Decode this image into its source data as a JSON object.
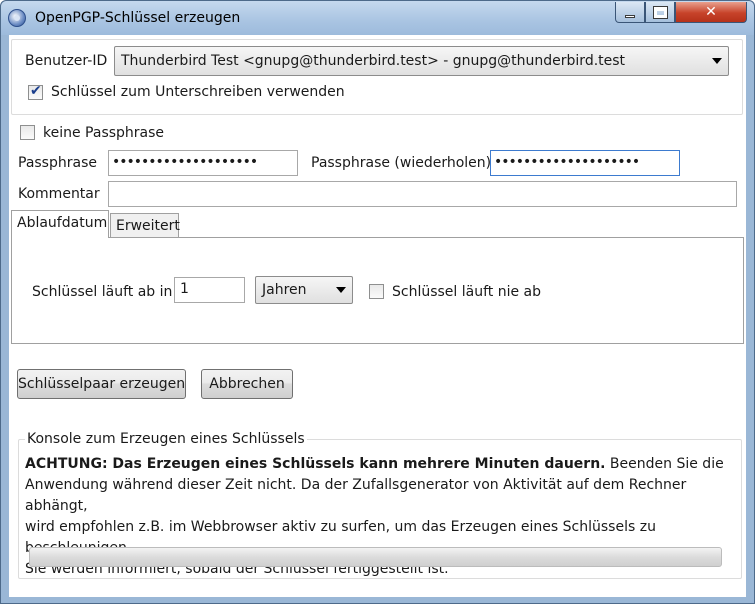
{
  "window": {
    "title": "OpenPGP-Schlüssel erzeugen",
    "title_color": "#a9c4e2",
    "close_color": "#c7432a"
  },
  "user": {
    "label": "Benutzer-ID",
    "selected": "Thunderbird Test <gnupg@thunderbird.test> - gnupg@thunderbird.test",
    "sign_checkbox_label": "Schlüssel zum Unterschreiben verwenden",
    "sign_checked": true
  },
  "passphrase": {
    "none_label": "keine Passphrase",
    "none_checked": false,
    "label": "Passphrase",
    "value": "••••••••••••••••••••",
    "repeat_label": "Passphrase (wiederholen)",
    "repeat_value": "••••••••••••••••••••"
  },
  "comment": {
    "label": "Kommentar",
    "value": ""
  },
  "tabs": [
    {
      "label": "Ablaufdatum",
      "active": true
    },
    {
      "label": "Erweitert",
      "active": false
    }
  ],
  "expiry": {
    "label": "Schlüssel läuft ab in",
    "amount": "1",
    "unit": "Jahren",
    "never_label": "Schlüssel läuft nie ab",
    "never_checked": false
  },
  "buttons": {
    "generate": "Schlüsselpaar erzeugen",
    "cancel": "Abbrechen"
  },
  "console": {
    "title": "Konsole zum Erzeugen eines Schlüssels",
    "warning_bold": "ACHTUNG: Das Erzeugen eines Schlüssels kann mehrere Minuten dauern.",
    "line1_rest": " Beenden Sie die",
    "line2": "Anwendung während dieser Zeit nicht. Da der Zufallsgenerator von Aktivität auf dem Rechner abhängt,",
    "line3": "wird empfohlen z.B. im Webbrowser aktiv zu surfen, um das Erzeugen eines Schlüssels zu beschleunigen.",
    "line4": "Sie werden informiert, sobald der Schlüssel fertiggestellt ist.",
    "progress": 0
  }
}
